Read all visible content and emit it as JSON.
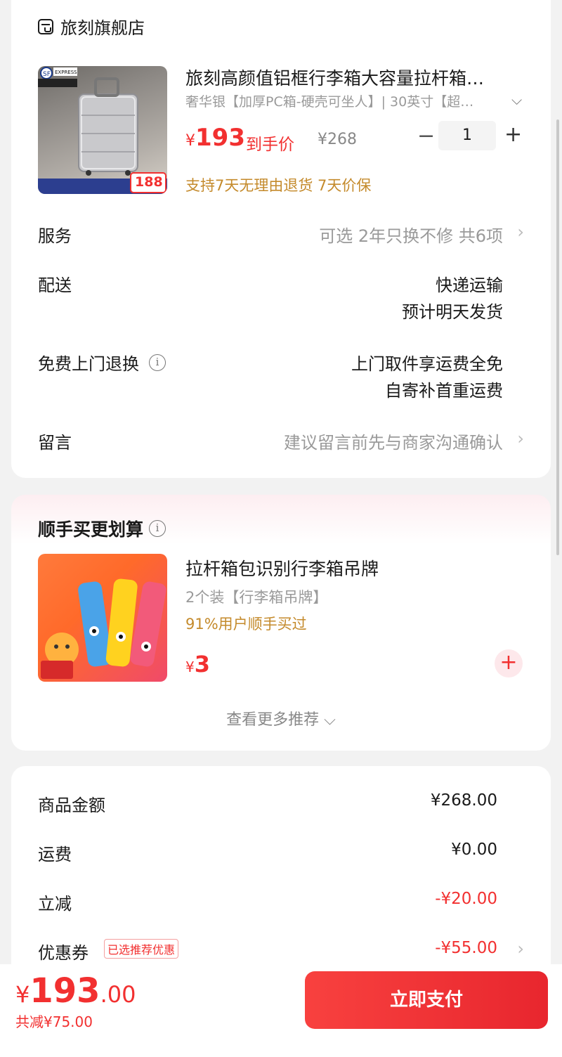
{
  "store": {
    "name": "旅刻旗舰店"
  },
  "product": {
    "thumb_price": "188",
    "title": "旅刻高颜值铝框行李箱大容量拉杆箱…",
    "spec": "奢华银【加厚PC箱-硬壳可坐人】| 30英寸【超…",
    "currency": "¥",
    "price": "193",
    "price_label": "到手价",
    "original_price": "¥268",
    "quantity": "1",
    "tags": "支持7天无理由退货  7天价保"
  },
  "rows": {
    "service": {
      "label": "服务",
      "value": "可选 2年只换不修 共6项"
    },
    "delivery": {
      "label": "配送",
      "value_1": "快递运输",
      "value_2": "预计明天发货"
    },
    "return": {
      "label": "免费上门退换",
      "value_1": "上门取件享运费全免",
      "value_2": "自寄补首重运费"
    },
    "message": {
      "label": "留言",
      "placeholder": "建议留言前先与商家沟通确认"
    }
  },
  "addon": {
    "section_title": "顺手买更划算",
    "title": "拉杆箱包识别行李箱吊牌",
    "spec": "2个装【行李箱吊牌】",
    "sold": "91%用户顺手买过",
    "currency": "¥",
    "price": "3",
    "see_more": "查看更多推荐"
  },
  "summary": {
    "goods_label": "商品金额",
    "goods_value": "¥268.00",
    "shipping_label": "运费",
    "shipping_value": "¥0.00",
    "discount_label": "立减",
    "discount_value": "-¥20.00",
    "coupon_label": "优惠券",
    "coupon_badge": "已选推荐优惠",
    "coupon_value": "-¥55.00"
  },
  "footer": {
    "currency": "¥",
    "total_int": "193",
    "total_dec": ".00",
    "saved": "共减¥75.00",
    "pay_label": "立即支付"
  },
  "colors": {
    "accent": "#f23030",
    "gold": "#c48a2b"
  }
}
